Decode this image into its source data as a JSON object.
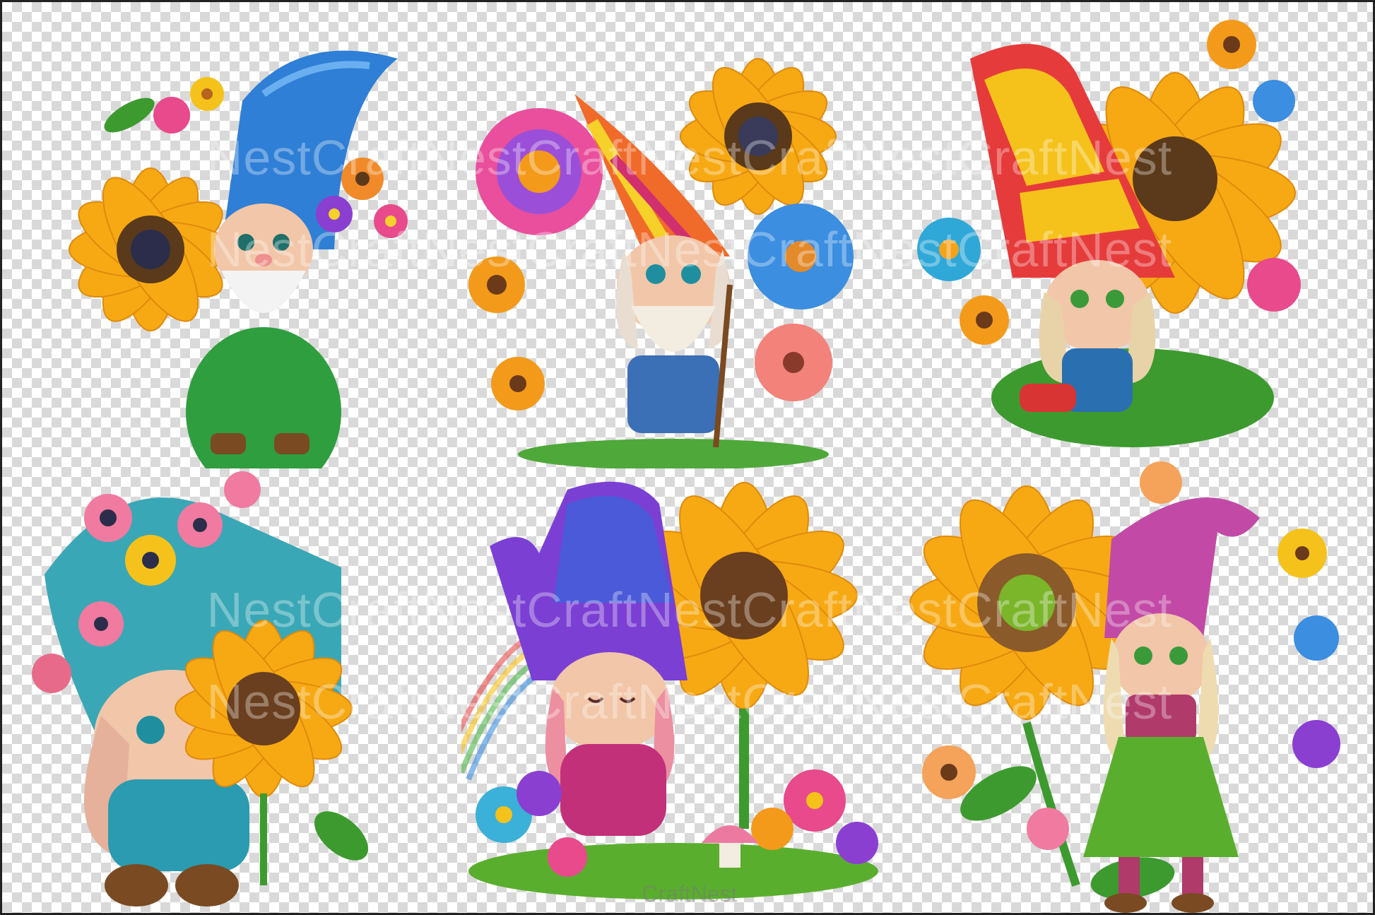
{
  "watermark": {
    "repeat_text": "CraftNest",
    "row_1": "NestCraftNestCraftNestCraftNestCraftNest",
    "row_2": "NestCraftNestCraftNestCraftNestCraftNest",
    "row_3": "NestCraftNestCraftNestCraftNestCraftNest",
    "row_4": "NestCraftNestCraftNestCraftNestCraftNest",
    "bottom": "CraftNest"
  },
  "gnomes": [
    {
      "hat": "#2f7fd6",
      "hat_dark": "#1b4fa0",
      "beard": true,
      "hair": "#2aa37a",
      "outfit": "#2f9e3f",
      "flower_main": "sunflower"
    },
    {
      "hat": "#f06a2a",
      "hat_dark": "#d12f6d",
      "beard": true,
      "hair": "#e8ddd0",
      "outfit": "#3b6fb6",
      "flower_main": "sunflower"
    },
    {
      "hat": "#e63b3b",
      "hat_dark": "#f5c21b",
      "beard": false,
      "hair": "#e8d3a8",
      "outfit": "#d83434",
      "flower_main": "sunflower"
    },
    {
      "hat": "#3aa7b6",
      "hat_dark": "#21808e",
      "beard": false,
      "hair": "#e6b19a",
      "outfit": "#2a9bb0",
      "flower_main": "sunflower"
    },
    {
      "hat": "#7b3fd4",
      "hat_dark": "#3f62d8",
      "beard": false,
      "hair": "#ec8fa0",
      "outfit": "#c2307a",
      "flower_main": "sunflower"
    },
    {
      "hat": "#c24aa6",
      "hat_dark": "#8e2d7c",
      "beard": false,
      "hair": "#eedcb0",
      "outfit": "#5aae2e",
      "flower_main": "sunflower"
    }
  ],
  "colors": {
    "checker_dark": "#d9d9d9",
    "checker_light": "#ffffff",
    "sunflower_petal": "#f7a914",
    "sunflower_center": "#5a3a1a",
    "leaf": "#3d9a2f"
  }
}
